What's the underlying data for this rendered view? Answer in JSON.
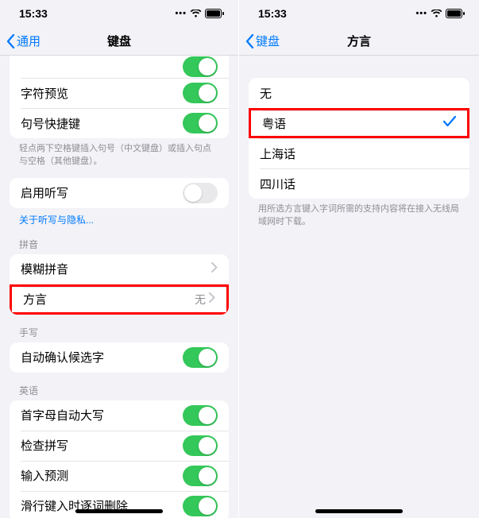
{
  "status": {
    "time": "15:33"
  },
  "left": {
    "back": "通用",
    "title": "键盘",
    "toggles": {
      "char_preview": "字符预览",
      "period_shortcut": "句号快捷键"
    },
    "shortcut_note": "轻点两下空格键插入句号（中文键盘）或插入句点与空格（其他键盘）。",
    "dictation": {
      "label": "启用听写"
    },
    "dictation_link": "关于听写与隐私...",
    "pinyin_header": "拼音",
    "fuzzy": "模糊拼音",
    "dialect": {
      "label": "方言",
      "value": "无"
    },
    "handwrite_header": "手写",
    "autoconfirm": "自动确认候选字",
    "english_header": "英语",
    "autocap": "首字母自动大写",
    "spellcheck": "检查拼写",
    "predictive": "输入预测",
    "slide_delete": "滑行键入时逐词删除"
  },
  "right": {
    "back": "键盘",
    "title": "方言",
    "options": {
      "none": "无",
      "cantonese": "粤语",
      "shanghainese": "上海话",
      "sichuanese": "四川话"
    },
    "footer": "用所选方言键入字词所需的支持内容将在接入无线局域网时下载。"
  }
}
